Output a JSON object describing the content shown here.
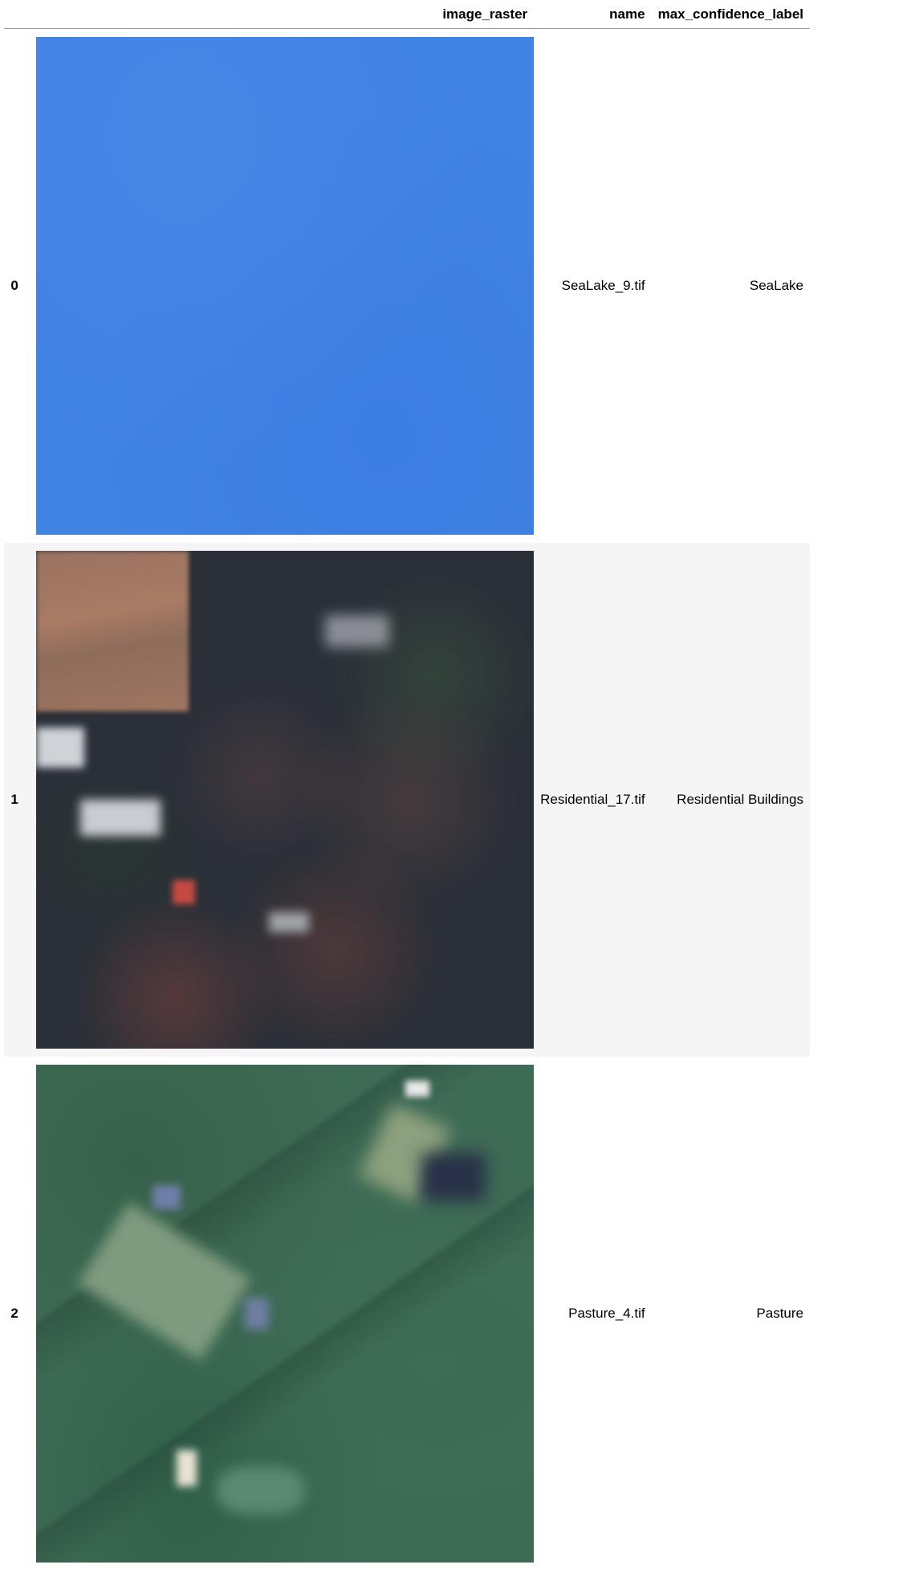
{
  "table": {
    "columns": [
      "image_raster",
      "name",
      "max_confidence_label"
    ],
    "rows": [
      {
        "index": "0",
        "image": "sea-lake-satellite-image",
        "name": "SeaLake_9.tif",
        "max_confidence_label": "SeaLake"
      },
      {
        "index": "1",
        "image": "residential-satellite-image",
        "name": "Residential_17.tif",
        "max_confidence_label": "Residential Buildings"
      },
      {
        "index": "2",
        "image": "pasture-satellite-image",
        "name": "Pasture_4.tif",
        "max_confidence_label": "Pasture"
      }
    ]
  },
  "colors": {
    "header_border": "#9a9a9a",
    "odd_row_bg": "#f5f5f5",
    "sea_blue": "#3f83e3"
  }
}
